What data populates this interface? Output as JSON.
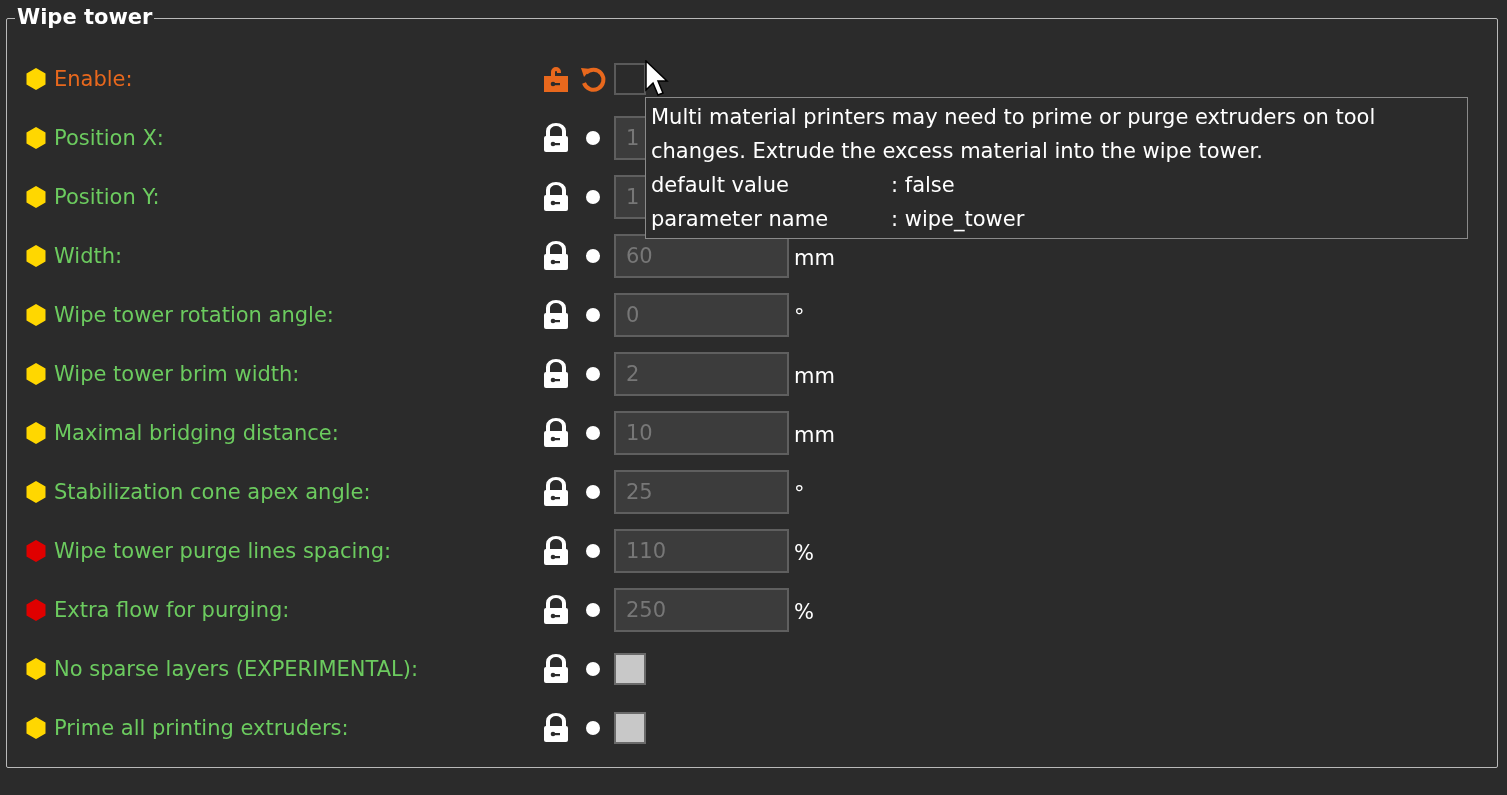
{
  "panel": {
    "title": "Wipe tower"
  },
  "rows": [
    {
      "label": "Enable:",
      "color": "#ffd700",
      "modified": true,
      "kind": "checkbox",
      "checked": false,
      "disabled": false
    },
    {
      "label": "Position X:",
      "color": "#ffd700",
      "modified": false,
      "kind": "number",
      "value": "1",
      "disabled": true
    },
    {
      "label": "Position Y:",
      "color": "#ffd700",
      "modified": false,
      "kind": "number",
      "value": "1",
      "disabled": true
    },
    {
      "label": "Width:",
      "color": "#ffd700",
      "modified": false,
      "kind": "number",
      "value": "60",
      "unit": "mm",
      "disabled": true
    },
    {
      "label": "Wipe tower rotation angle:",
      "color": "#ffd700",
      "modified": false,
      "kind": "number",
      "value": "0",
      "unit": "°",
      "disabled": true
    },
    {
      "label": "Wipe tower brim width:",
      "color": "#ffd700",
      "modified": false,
      "kind": "number",
      "value": "2",
      "unit": "mm",
      "disabled": true
    },
    {
      "label": "Maximal bridging distance:",
      "color": "#ffd700",
      "modified": false,
      "kind": "number",
      "value": "10",
      "unit": "mm",
      "disabled": true
    },
    {
      "label": "Stabilization cone apex angle:",
      "color": "#ffd700",
      "modified": false,
      "kind": "number",
      "value": "25",
      "unit": "°",
      "disabled": true
    },
    {
      "label": "Wipe tower purge lines spacing:",
      "color": "#e00000",
      "modified": false,
      "kind": "number",
      "value": "110",
      "unit": "%",
      "disabled": true
    },
    {
      "label": "Extra flow for purging:",
      "color": "#e00000",
      "modified": false,
      "kind": "number",
      "value": "250",
      "unit": "%",
      "disabled": true
    },
    {
      "label": "No sparse layers (EXPERIMENTAL):",
      "color": "#ffd700",
      "modified": false,
      "kind": "checkbox",
      "checked": false,
      "disabled": true
    },
    {
      "label": "Prime all printing extruders:",
      "color": "#ffd700",
      "modified": false,
      "kind": "checkbox",
      "checked": false,
      "disabled": true
    }
  ],
  "tooltip": {
    "description": "Multi material printers may need to prime or purge extruders on tool changes. Extrude the excess material into the wipe tower.",
    "details": [
      {
        "label": "default value",
        "value": ": false"
      },
      {
        "label": "parameter name",
        "value": ": wipe_tower"
      }
    ]
  }
}
